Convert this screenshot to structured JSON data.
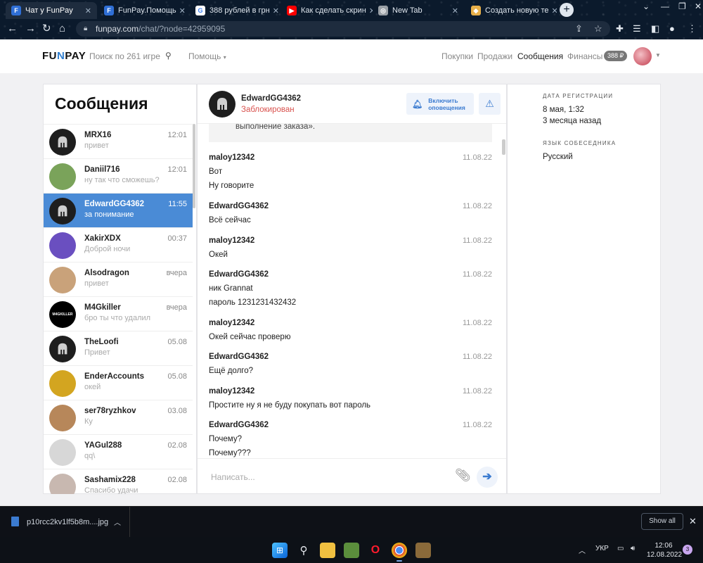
{
  "browser": {
    "tabs": [
      {
        "title": "Чат у FunPay",
        "favicon_color": "#2f6fd6",
        "favicon_text": "F"
      },
      {
        "title": "FunPay.Помощь",
        "favicon_color": "#2f6fd6",
        "favicon_text": "F"
      },
      {
        "title": "388 рублей в грн",
        "favicon_color": "#ffffff",
        "favicon_text": "G"
      },
      {
        "title": "Как сделать скрин",
        "favicon_color": "#ff0000",
        "favicon_text": "▶"
      },
      {
        "title": "New Tab",
        "favicon_color": "#9aa0a6",
        "favicon_text": "◎"
      },
      {
        "title": "Создать новую те",
        "favicon_color": "#e8b04a",
        "favicon_text": "◆"
      }
    ],
    "url_host": "funpay.com",
    "url_path": "/chat/?node=42959095"
  },
  "site": {
    "logo_left": "FU",
    "logo_accent": "N",
    "logo_right": "PAY",
    "search_placeholder": "Поиск по 261 игре",
    "help_label": "Помощь",
    "nav": [
      "Покупки",
      "Продажи",
      "Сообщения",
      "Финансы"
    ],
    "balance": "388 ₽"
  },
  "contacts": {
    "title": "Сообщения",
    "items": [
      {
        "name": "MRX16",
        "message": "привет",
        "time": "12:01",
        "avatar_color": "#1e1e1e",
        "avatar_text": ""
      },
      {
        "name": "Daniil716",
        "message": "ну так что сможешь?",
        "time": "12:01",
        "avatar_color": "#7aa35a",
        "avatar_text": ""
      },
      {
        "name": "EdwardGG4362",
        "message": "за понимание",
        "time": "11:55",
        "avatar_color": "#1e1e1e",
        "avatar_text": ""
      },
      {
        "name": "XakirXDX",
        "message": "Доброй ночи",
        "time": "00:37",
        "avatar_color": "#6a4fc0",
        "avatar_text": ""
      },
      {
        "name": "Alsodragon",
        "message": "привет",
        "time": "вчера",
        "avatar_color": "#c9a27a",
        "avatar_text": ""
      },
      {
        "name": "M4Gkiller",
        "message": "бро ты что удалил",
        "time": "вчера",
        "avatar_color": "#000000",
        "avatar_text": "M4GKILLER"
      },
      {
        "name": "TheLoofi",
        "message": "Привет",
        "time": "05.08",
        "avatar_color": "#1e1e1e",
        "avatar_text": ""
      },
      {
        "name": "EnderAccounts",
        "message": "окей",
        "time": "05.08",
        "avatar_color": "#d3a520",
        "avatar_text": ""
      },
      {
        "name": "ser78ryzhkov",
        "message": "Ку",
        "time": "03.08",
        "avatar_color": "#b7875a",
        "avatar_text": ""
      },
      {
        "name": "YAGul288",
        "message": "qq\\",
        "time": "02.08",
        "avatar_color": "#d7d7d7",
        "avatar_text": ""
      },
      {
        "name": "Sashamix228",
        "message": "Спасибо удачи",
        "time": "02.08",
        "avatar_color": "#c8b8b0",
        "avatar_text": ""
      }
    ]
  },
  "chat": {
    "name": "EdwardGG4362",
    "status": "Заблокирован",
    "notify_line1": "Включить",
    "notify_line2": "оповещения",
    "quote_tail": "выполнение заказа».",
    "messages": [
      {
        "author": "maloy12342",
        "date": "11.08.22",
        "lines": [
          "Вот",
          "Ну говорите"
        ]
      },
      {
        "author": "EdwardGG4362",
        "date": "11.08.22",
        "lines": [
          "Всё сейчас"
        ]
      },
      {
        "author": "maloy12342",
        "date": "11.08.22",
        "lines": [
          "Окей"
        ]
      },
      {
        "author": "EdwardGG4362",
        "date": "11.08.22",
        "lines": [
          "ник Grannat",
          "пароль 1231231432432"
        ]
      },
      {
        "author": "maloy12342",
        "date": "11.08.22",
        "lines": [
          "Окей сейчас проверю"
        ]
      },
      {
        "author": "EdwardGG4362",
        "date": "11.08.22",
        "lines": [
          "Ещё долго?"
        ]
      },
      {
        "author": "maloy12342",
        "date": "11.08.22",
        "lines": [
          "Простите ну я не буду покупать вот пароль"
        ]
      },
      {
        "author": "EdwardGG4362",
        "date": "11.08.22",
        "lines": [
          "Почему?",
          "Почему???"
        ]
      }
    ],
    "composer_placeholder": "Написать..."
  },
  "info": {
    "reg_label": "ДАТА РЕГИСТРАЦИИ",
    "reg_date": "8 мая, 1:32",
    "reg_ago": "3 месяца назад",
    "lang_label": "ЯЗЫК СОБЕСЕДНИКА",
    "lang_value": "Русский"
  },
  "downloads": {
    "file": "p10rcc2kv1lf5b8m....jpg",
    "show_all": "Show all"
  },
  "taskbar": {
    "lang": "УКР",
    "time": "12:06",
    "date": "12.08.2022",
    "notifications": "3"
  }
}
